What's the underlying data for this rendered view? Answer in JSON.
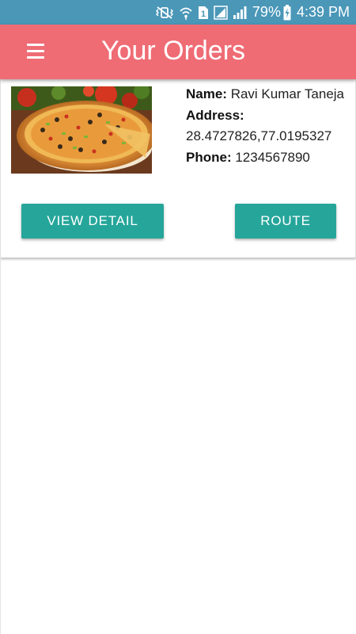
{
  "status_bar": {
    "battery_percent": "79%",
    "time": "4:39 PM",
    "sim_slot": "1",
    "icons": [
      "mute-vibrate-icon",
      "wifi-icon",
      "sim-1-icon",
      "signal-icon",
      "signal-icon",
      "battery-charging-icon"
    ]
  },
  "app_bar": {
    "title": "Your Orders",
    "menu_icon": "hamburger-menu-icon",
    "color": "#ef6c75"
  },
  "orders": [
    {
      "image": "pizza-image",
      "name_label": "Name:",
      "name_value": "Ravi Kumar Taneja",
      "address_label": "Address:",
      "address_value": "28.4727826,77.0195327",
      "phone_label": "Phone:",
      "phone_value": "1234567890",
      "view_detail_label": "VIEW DETAIL",
      "route_label": "ROUTE"
    }
  ],
  "colors": {
    "status_bar": "#4a97b8",
    "button": "#26a69a"
  }
}
